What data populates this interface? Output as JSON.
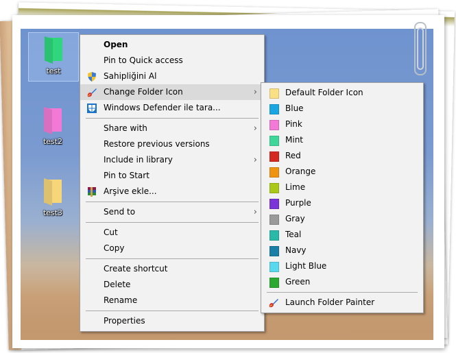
{
  "desktop": {
    "icons": [
      {
        "label": "test",
        "color": "#2fd67e",
        "selected": true
      },
      {
        "label": "test2",
        "color": "#f27ad6",
        "selected": false
      },
      {
        "label": "test3",
        "color": "#f7d67a",
        "selected": false
      }
    ]
  },
  "context_menu": {
    "items": [
      {
        "label": "Open",
        "bold": true
      },
      {
        "label": "Pin to Quick access"
      },
      {
        "label": "Sahipliğini Al",
        "icon": "uac-shield-icon"
      },
      {
        "label": "Change Folder Icon",
        "icon": "paintbrush-icon",
        "submenu": true,
        "highlighted": true
      },
      {
        "label": "Windows Defender ile tara...",
        "icon": "windows-defender-icon"
      },
      {
        "label": "Share with",
        "submenu": true
      },
      {
        "label": "Restore previous versions"
      },
      {
        "label": "Include in library",
        "submenu": true
      },
      {
        "label": "Pin to Start"
      },
      {
        "label": "Arşive ekle...",
        "icon": "winrar-archive-icon"
      },
      {
        "label": "Send to",
        "submenu": true
      },
      {
        "label": "Cut"
      },
      {
        "label": "Copy"
      },
      {
        "label": "Create shortcut"
      },
      {
        "label": "Delete"
      },
      {
        "label": "Rename"
      },
      {
        "label": "Properties"
      }
    ],
    "submenu_arrow": "›"
  },
  "folder_submenu": {
    "items": [
      {
        "label": "Default Folder Icon",
        "color": "#f9df86"
      },
      {
        "label": "Blue",
        "color": "#1aa6e0"
      },
      {
        "label": "Pink",
        "color": "#f27ad6"
      },
      {
        "label": "Mint",
        "color": "#3fd69a"
      },
      {
        "label": "Red",
        "color": "#d42a22"
      },
      {
        "label": "Orange",
        "color": "#ef9410"
      },
      {
        "label": "Lime",
        "color": "#a9c81a"
      },
      {
        "label": "Purple",
        "color": "#7a34d8"
      },
      {
        "label": "Gray",
        "color": "#9a9a9a"
      },
      {
        "label": "Teal",
        "color": "#2ab8a8"
      },
      {
        "label": "Navy",
        "color": "#1a7ea6"
      },
      {
        "label": "Light Blue",
        "color": "#5ad8ee"
      },
      {
        "label": "Green",
        "color": "#2aa832"
      }
    ],
    "launch_label": "Launch Folder Painter"
  }
}
